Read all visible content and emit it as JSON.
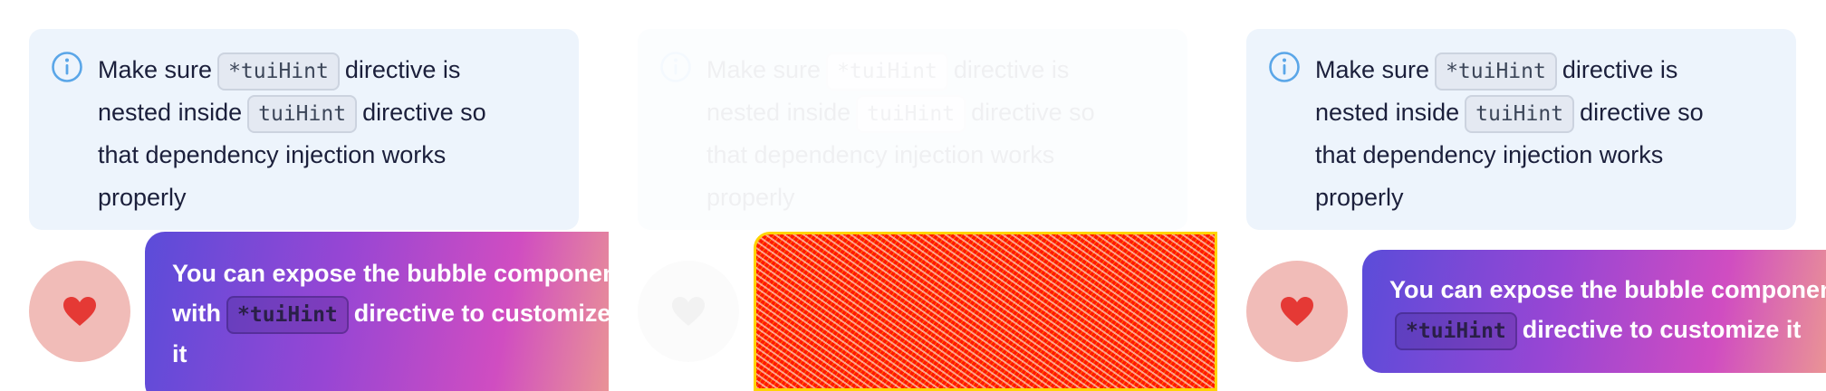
{
  "notice": {
    "line1_before": "Make sure",
    "code1": "*tuiHint",
    "line1_after": "directive is",
    "line2_before": "nested inside",
    "code2": "tuiHint",
    "line2_after": "directive so",
    "line3": "that dependency injection works",
    "line4": "properly"
  },
  "bubble": {
    "line1": "You can expose the bubble component",
    "with": "with",
    "code": "*tuiHint",
    "after_code": "directive to customize",
    "line3": "it"
  },
  "bubble_wide": {
    "line1": "You can expose the bubble component with",
    "code": "*tuiHint",
    "after_code": "directive to customize it"
  },
  "colors": {
    "notice_bg": "#edf4fc",
    "info_icon": "#5aa6e8",
    "avatar_bg": "#f1bcb8",
    "heart": "#e53935"
  },
  "icons": {
    "info": "info-icon",
    "heart": "heart-icon"
  }
}
